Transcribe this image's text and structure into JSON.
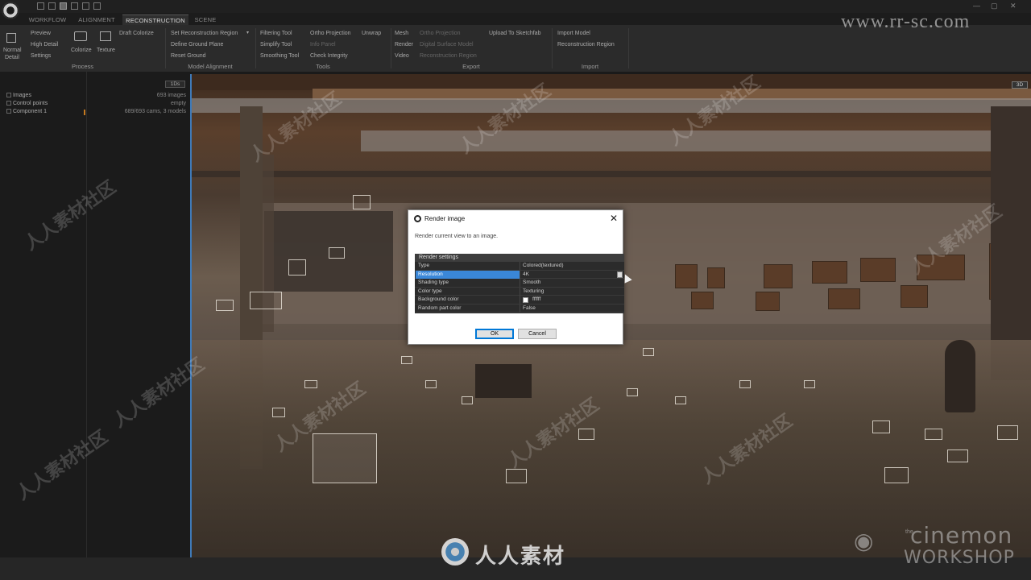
{
  "quick_access": [
    "workspace-icon-1",
    "workspace-icon-2",
    "workspace-icon-3",
    "workspace-icon-4"
  ],
  "tabs": [
    {
      "label": "WORKFLOW",
      "active": false
    },
    {
      "label": "ALIGNMENT",
      "active": false
    },
    {
      "label": "RECONSTRUCTION",
      "active": true
    },
    {
      "label": "SCENE",
      "active": false
    }
  ],
  "ribbon": {
    "process": {
      "group_label": "Process",
      "normal_detail": [
        "Normal",
        "Detail"
      ],
      "preview": "Preview",
      "high_detail": "High Detail",
      "settings": "Settings",
      "colorize": "Colorize",
      "texture": "Texture",
      "draft_colorize": "Draft Colorize"
    },
    "model_alignment": {
      "group_label": "Model Alignment",
      "set_region": "Set Reconstruction Region",
      "define_ground": "Define Ground Plane",
      "reset_ground": "Reset Ground"
    },
    "tools": {
      "group_label": "Tools",
      "filtering": "Filtering Tool",
      "simplify": "Simplify Tool",
      "smoothing": "Smoothing Tool",
      "ortho": "Ortho Projection",
      "info": "Info Panel",
      "check": "Check Integrity",
      "unwrap": "Unwrap"
    },
    "export": {
      "group_label": "Export",
      "mesh": "Mesh",
      "render": "Render",
      "video": "Video",
      "ortho": "Ortho Projection",
      "dsm": "Digital Surface Model",
      "region": "Reconstruction Region",
      "sketchfab": "Upload To Sketchfab"
    },
    "import": {
      "group_label": "Import",
      "model": "Import Model",
      "region": "Reconstruction Region"
    }
  },
  "tree": [
    {
      "label": "Images",
      "value": "693 images"
    },
    {
      "label": "Control points",
      "value": "empty"
    },
    {
      "label": "Component 1",
      "value": "689/693 cams, 3 models"
    }
  ],
  "panel_badge": "1Ds",
  "viewport_badge": "3D",
  "dialog": {
    "title": "Render image",
    "message": "Render current view to an image.",
    "section": "Render settings",
    "rows": [
      {
        "key": "Type",
        "value": "Colored(textured)"
      },
      {
        "key": "Resolution",
        "value": "4K",
        "selected": true
      },
      {
        "key": "Shading type",
        "value": "Smooth"
      },
      {
        "key": "Color type",
        "value": "Texturing"
      },
      {
        "key": "Background color",
        "value": "ffffff",
        "swatch": "#ffffff"
      },
      {
        "key": "Random part color",
        "value": "False"
      }
    ],
    "ok": "OK",
    "cancel": "Cancel"
  },
  "watermarks": {
    "url": "www.rr-sc.com",
    "bottom_text": "人人素材",
    "repeat_text": "人人素材社区",
    "brand_line1": "cinemon",
    "brand_line2": "WORKSHOP",
    "brand_small": "the",
    "pin_glyph": "◉"
  },
  "colors": {
    "accent_blue": "#3a87d8",
    "viewport_border": "#3f7ab8",
    "ok_border": "#0078d7"
  }
}
